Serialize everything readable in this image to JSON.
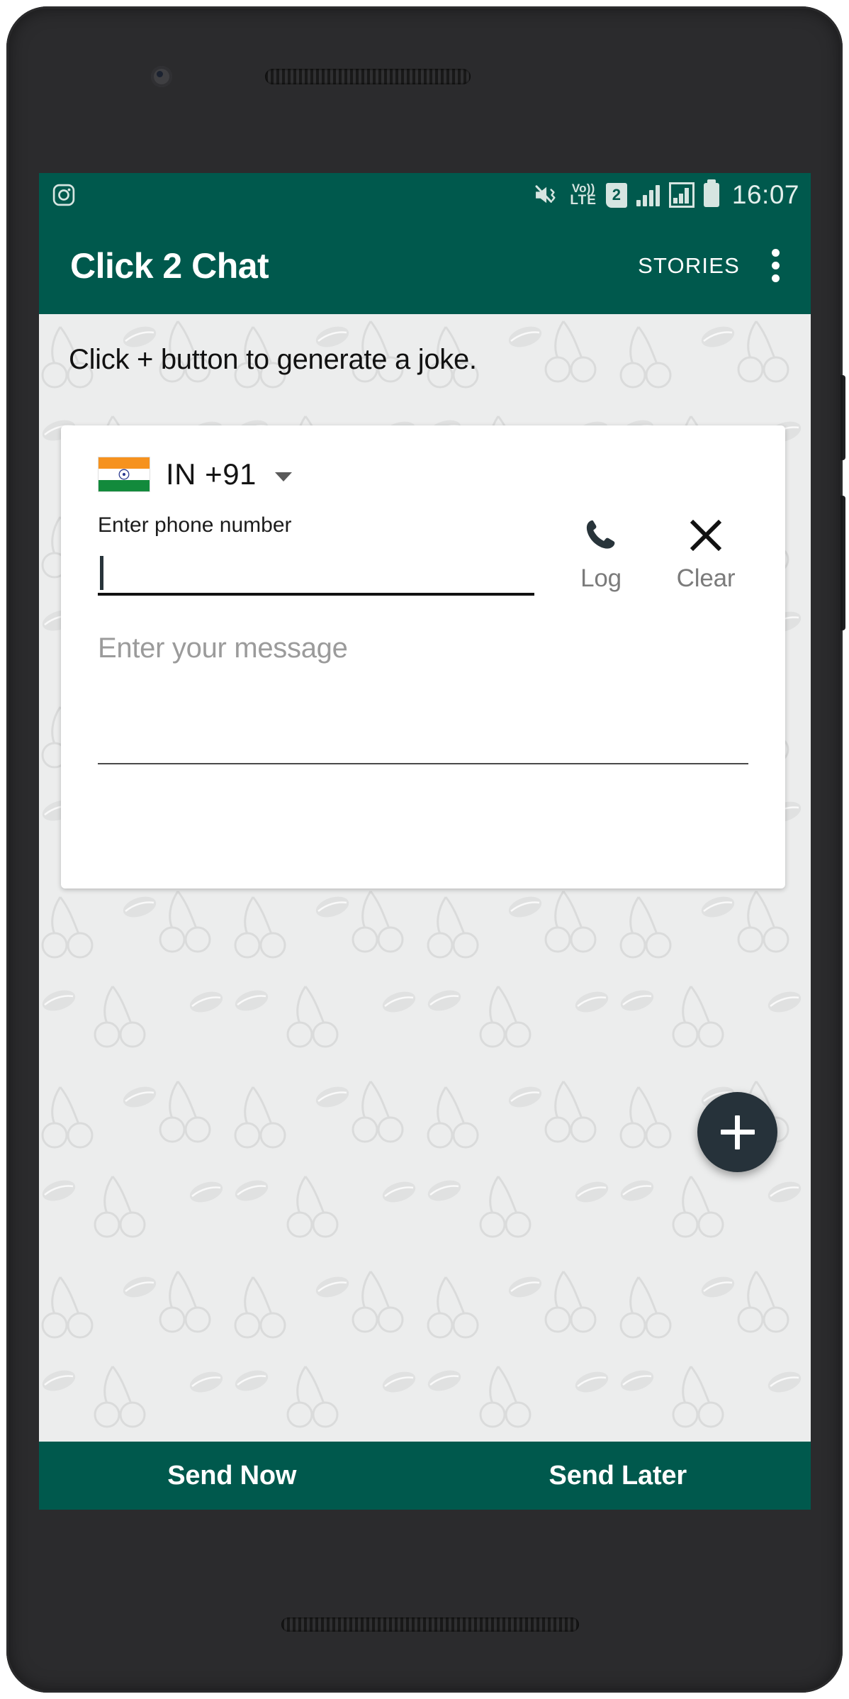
{
  "statusbar": {
    "app_icon": "instagram-icon",
    "icons": [
      "mute-vibrate-icon",
      "volte-icon",
      "sim-2-icon",
      "signal-bars-icon",
      "signal-box-icon",
      "battery-icon"
    ],
    "volte_top": "Vo))",
    "volte_bottom": "LTE",
    "sim_number": "2",
    "time": "16:07"
  },
  "appbar": {
    "title": "Click 2 Chat",
    "stories_label": "STORIES",
    "overflow_label": "more-options"
  },
  "content": {
    "joke_hint": "Click + button to generate a joke."
  },
  "card": {
    "country": {
      "flag": "india-flag",
      "code_label": "IN  +91",
      "caret": "chevron-down-icon"
    },
    "phone": {
      "label": "Enter phone number",
      "value": "",
      "placeholder": ""
    },
    "actions": [
      {
        "icon": "phone-icon",
        "label": "Log"
      },
      {
        "icon": "close-x-icon",
        "label": "Clear"
      }
    ],
    "message": {
      "placeholder": "Enter your message",
      "value": ""
    }
  },
  "fab": {
    "icon": "plus-icon",
    "label": "Add"
  },
  "bottombar": {
    "send_now": "Send Now",
    "send_later": "Send Later"
  },
  "colors": {
    "brand_green": "#00594d",
    "fab_dark": "#26323a",
    "wallpaper_bg": "#eceded"
  }
}
